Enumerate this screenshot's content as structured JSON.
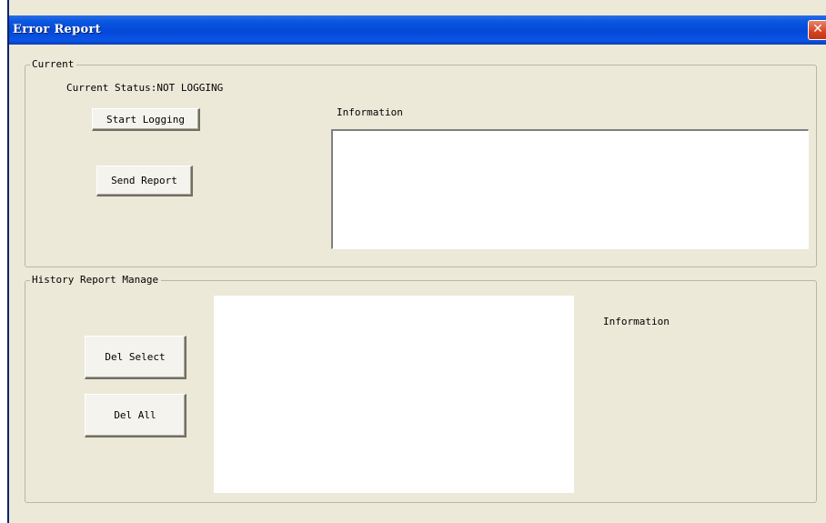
{
  "window": {
    "title": "Error Report",
    "close_glyph": "✕"
  },
  "current": {
    "group_label": "Current",
    "status_text": "Current Status:NOT LOGGING",
    "start_logging_label": "Start Logging",
    "send_report_label": "Send Report",
    "information_label": "Information",
    "information_value": ""
  },
  "history": {
    "group_label": "History Report Manage",
    "del_select_label": "Del Select",
    "del_all_label": "Del All",
    "information_label": "Information",
    "report_list_items": []
  }
}
